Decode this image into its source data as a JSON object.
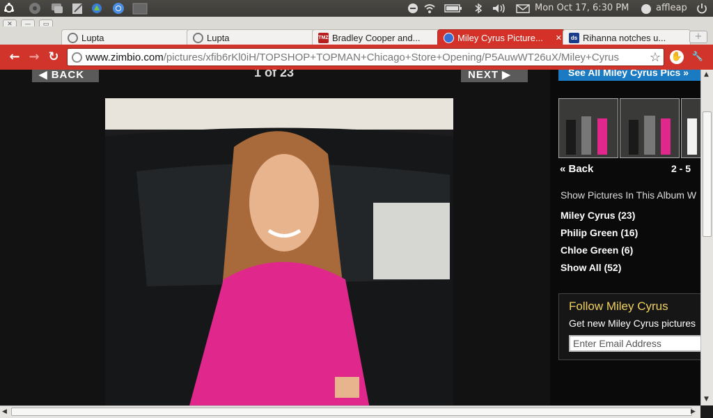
{
  "panel": {
    "datetime": "Mon Oct 17,  6:30 PM",
    "user": "affleap",
    "icons": [
      "ubuntu-logo-icon",
      "system-icon",
      "chat-icon",
      "edit-icon",
      "tools-icon",
      "chrome-icon",
      "window-icon"
    ],
    "tray": [
      "media-stop-icon",
      "wifi-icon",
      "battery-icon",
      "bluetooth-icon",
      "volume-icon",
      "mail-icon",
      "user-icon",
      "power-icon"
    ]
  },
  "window": {
    "controls": [
      "close",
      "minimize",
      "maximize"
    ]
  },
  "tabs": [
    {
      "title": "Lupta",
      "active": false
    },
    {
      "title": "Lupta",
      "active": false
    },
    {
      "title": "Bradley Cooper and...",
      "active": false
    },
    {
      "title": "Miley Cyrus Picture...",
      "active": true
    },
    {
      "title": "Rihanna notches u...",
      "active": false
    }
  ],
  "toolbar": {
    "url_host": "www.zimbio.com",
    "url_path": "/pictures/xfib6rKl0iH/TOPSHOP+TOPMAN+Chicago+Store+Opening/P5AuwWT26uX/Miley+Cyrus"
  },
  "page": {
    "back_label": "◀ BACK",
    "next_label": "NEXT ▶",
    "counter": "1  of  23"
  },
  "sidebar": {
    "see_all": "See All Miley Cyrus Pics »",
    "back_link": "« Back",
    "range": "2 - 5",
    "show_label": "Show Pictures In This Album W",
    "albums": [
      "Miley Cyrus (23)",
      "Philip Green (16)",
      "Chloe Green (6)",
      "Show All (52)"
    ],
    "follow_title": "Follow Miley Cyrus",
    "follow_sub": "Get new Miley Cyrus pictures",
    "email_placeholder": "Enter Email Address"
  },
  "colors": {
    "chrome_red": "#d0342a",
    "page_bg": "#121212",
    "accent_blue": "#1a7ac2",
    "follow_yellow": "#f0d060"
  }
}
